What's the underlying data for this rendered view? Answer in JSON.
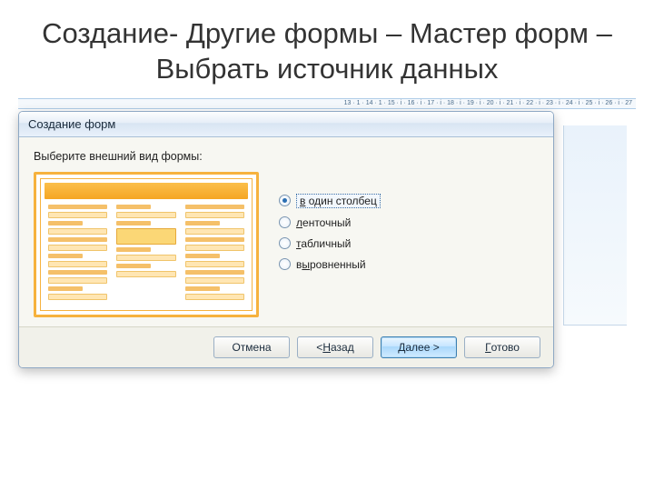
{
  "slide": {
    "title": "Создание- Другие формы – Мастер форм – Выбрать источник данных"
  },
  "ruler": {
    "trail": "13 · 1 · 14 · 1 · 15 · i · 16 · i · 17 · i · 18 · i · 19 · i · 20 · i · 21 · i · 22 · i · 23 · i · 24 · i · 25 · i · 26 · i · 27"
  },
  "dialog": {
    "title": "Создание форм",
    "instruction": "Выберите внешний вид формы:",
    "options": [
      {
        "label_pre": "",
        "mnemonic": "в",
        "label_post": " один столбец",
        "checked": true,
        "boxed": true
      },
      {
        "label_pre": "",
        "mnemonic": "л",
        "label_post": "енточный",
        "checked": false,
        "boxed": false
      },
      {
        "label_pre": "",
        "mnemonic": "т",
        "label_post": "абличный",
        "checked": false,
        "boxed": false
      },
      {
        "label_pre": "в",
        "mnemonic": "ы",
        "label_post": "ровненный",
        "checked": false,
        "boxed": false
      }
    ],
    "buttons": {
      "cancel": "Отмена",
      "back_pre": "< ",
      "back_mn": "Н",
      "back_post": "азад",
      "next_pre": "",
      "next_mn": "Д",
      "next_post": "алее >",
      "finish_pre": "",
      "finish_mn": "Г",
      "finish_post": "отово"
    }
  }
}
